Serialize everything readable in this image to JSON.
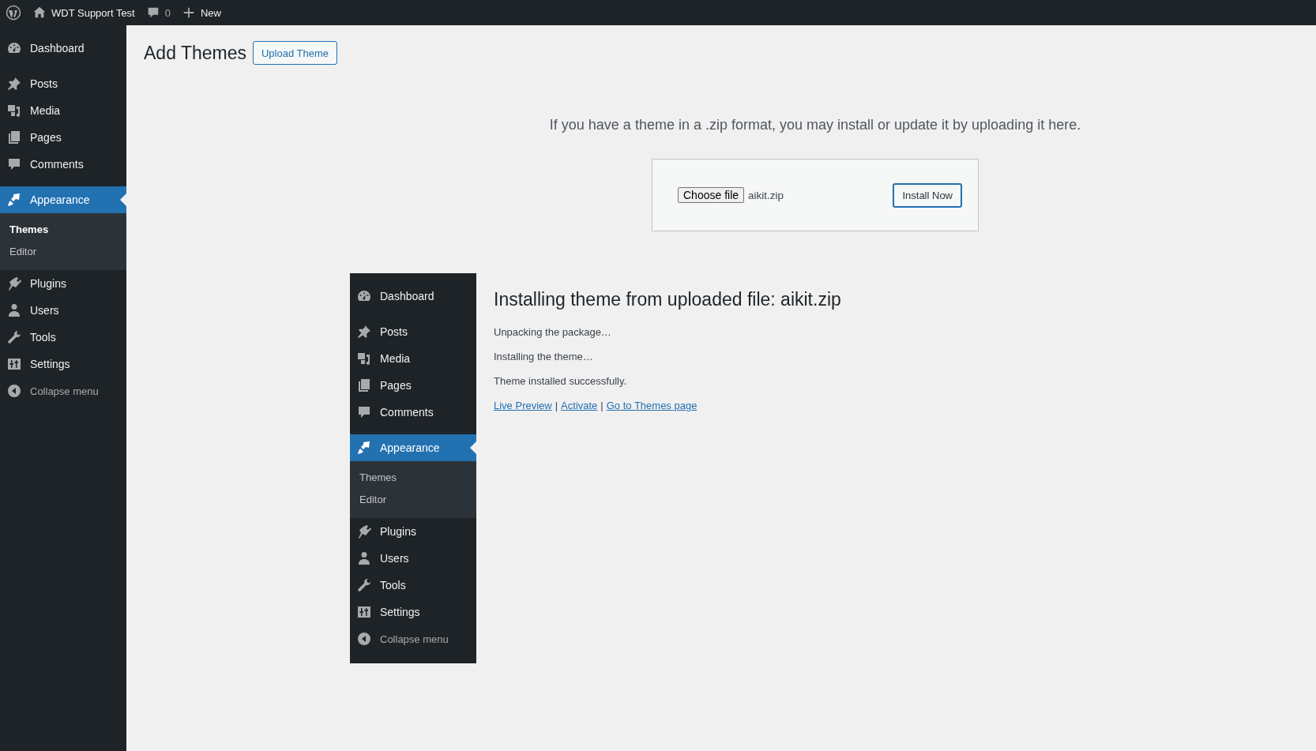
{
  "admin_bar": {
    "site_name": "WDT Support Test",
    "comment_count": "0",
    "new_label": "New"
  },
  "sidebar": {
    "items": [
      {
        "label": "Dashboard",
        "kind": "item",
        "selected": false
      },
      {
        "label": "Posts",
        "kind": "item",
        "selected": false
      },
      {
        "label": "Media",
        "kind": "item",
        "selected": false
      },
      {
        "label": "Pages",
        "kind": "item",
        "selected": false
      },
      {
        "label": "Comments",
        "kind": "item",
        "selected": false
      },
      {
        "label": "Appearance",
        "kind": "item",
        "selected": true,
        "children": [
          {
            "label": "Themes",
            "selected": true
          },
          {
            "label": "Editor",
            "selected": false
          }
        ]
      },
      {
        "label": "Plugins",
        "kind": "item",
        "selected": false
      },
      {
        "label": "Users",
        "kind": "item",
        "selected": false
      },
      {
        "label": "Tools",
        "kind": "item",
        "selected": false
      },
      {
        "label": "Settings",
        "kind": "item",
        "selected": false
      },
      {
        "label": "Collapse menu",
        "kind": "collapse",
        "selected": false
      }
    ]
  },
  "page": {
    "title": "Add Themes",
    "upload_button": "Upload Theme",
    "intro": "If you have a theme in a .zip format, you may install or update it by uploading it here.",
    "choose_file_button": "Choose file",
    "file_name": "aikit.zip",
    "install_button": "Install Now"
  },
  "inner_sidebar": {
    "items": [
      {
        "label": "Dashboard",
        "kind": "item",
        "selected": false
      },
      {
        "label": "Posts",
        "kind": "item",
        "selected": false
      },
      {
        "label": "Media",
        "kind": "item",
        "selected": false
      },
      {
        "label": "Pages",
        "kind": "item",
        "selected": false
      },
      {
        "label": "Comments",
        "kind": "item",
        "selected": false
      },
      {
        "label": "Appearance",
        "kind": "item",
        "selected": true,
        "children": [
          {
            "label": "Themes",
            "selected": false
          },
          {
            "label": "Editor",
            "selected": false
          }
        ]
      },
      {
        "label": "Plugins",
        "kind": "item",
        "selected": false
      },
      {
        "label": "Users",
        "kind": "item",
        "selected": false
      },
      {
        "label": "Tools",
        "kind": "item",
        "selected": false
      },
      {
        "label": "Settings",
        "kind": "item",
        "selected": false
      },
      {
        "label": "Collapse menu",
        "kind": "collapse",
        "selected": false
      }
    ]
  },
  "install_log": {
    "heading": "Installing theme from uploaded file: aikit.zip",
    "messages": [
      "Unpacking the package…",
      "Installing the theme…",
      "Theme installed successfully."
    ],
    "links": [
      "Live Preview",
      "Activate",
      "Go to Themes page"
    ],
    "separator": "|"
  }
}
